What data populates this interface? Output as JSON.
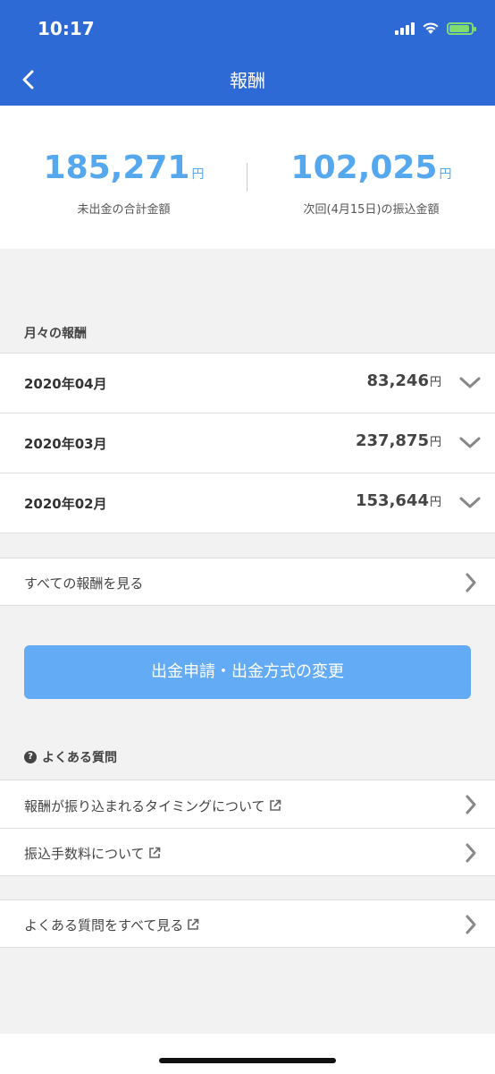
{
  "status": {
    "time": "10:17"
  },
  "nav": {
    "title": "報酬"
  },
  "summary": {
    "unpaid_amount": "185,271",
    "unpaid_unit": "円",
    "unpaid_label": "未出金の合計金額",
    "next_amount": "102,025",
    "next_unit": "円",
    "next_label": "次回(4月15日)の振込金額"
  },
  "monthly": {
    "title": "月々の報酬",
    "items": [
      {
        "month": "2020年04月",
        "amount": "83,246",
        "unit": "円"
      },
      {
        "month": "2020年03月",
        "amount": "237,875",
        "unit": "円"
      },
      {
        "month": "2020年02月",
        "amount": "153,644",
        "unit": "円"
      }
    ],
    "see_all": "すべての報酬を見る"
  },
  "withdraw_button": "出金申請・出金方式の変更",
  "faq": {
    "title": "よくある質問",
    "icon": "question-circle-icon",
    "items": [
      {
        "label": "報酬が振り込まれるタイミングについて"
      },
      {
        "label": "振込手数料について"
      }
    ],
    "see_all": "よくある質問をすべて見る"
  },
  "colors": {
    "header": "#2d6ad6",
    "accent": "#55a7ee",
    "button": "#63abf5"
  }
}
